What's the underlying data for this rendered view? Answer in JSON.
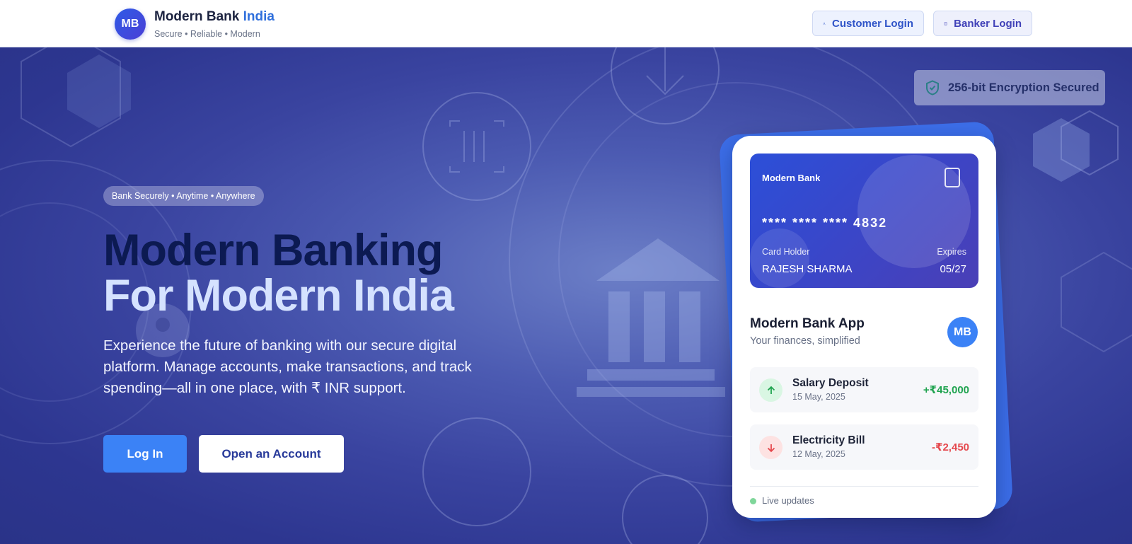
{
  "header": {
    "logo_initials": "MB",
    "brand_name": "Modern Bank",
    "brand_accent": "India",
    "tagline": "Secure • Reliable • Modern",
    "customer_login_label": "Customer Login",
    "banker_login_label": "Banker Login",
    "customer_login_icon": "user-icon",
    "banker_login_icon": "building-icon"
  },
  "hero": {
    "security_badge": "256-bit Encryption Secured",
    "security_icon": "shield-check-icon",
    "pill_text": "Bank Securely • Anytime • Anywhere",
    "headline_line1": "Modern Banking",
    "headline_line2": "For Modern India",
    "description": "Experience the future of banking with our secure digital platform. Manage accounts, make transactions, and track spending—all in one place, with ₹ INR support.",
    "login_button": "Log In",
    "open_account_button": "Open an Account"
  },
  "app_preview": {
    "card": {
      "bank_name": "Modern Bank",
      "masked_number": "****  ****  ****  4832",
      "holder_label": "Card Holder",
      "holder_name": "RAJESH SHARMA",
      "expires_label": "Expires",
      "expiry": "05/27"
    },
    "app_title": "Modern Bank App",
    "app_subtitle": "Your finances, simplified",
    "app_badge": "MB",
    "transactions": [
      {
        "name": "Salary Deposit",
        "date": "15 May, 2025",
        "amount": "+₹45,000",
        "direction": "credit",
        "icon": "arrow-up-icon"
      },
      {
        "name": "Electricity Bill",
        "date": "12 May, 2025",
        "amount": "-₹2,450",
        "direction": "debit",
        "icon": "arrow-down-icon"
      }
    ],
    "live_status": "Live updates"
  },
  "colors": {
    "accent": "#3b82f6",
    "brand_accent": "#2f6fdc",
    "credit": "#1fa34f",
    "debit": "#e5484d",
    "hero_bg": "#3a44a0"
  }
}
